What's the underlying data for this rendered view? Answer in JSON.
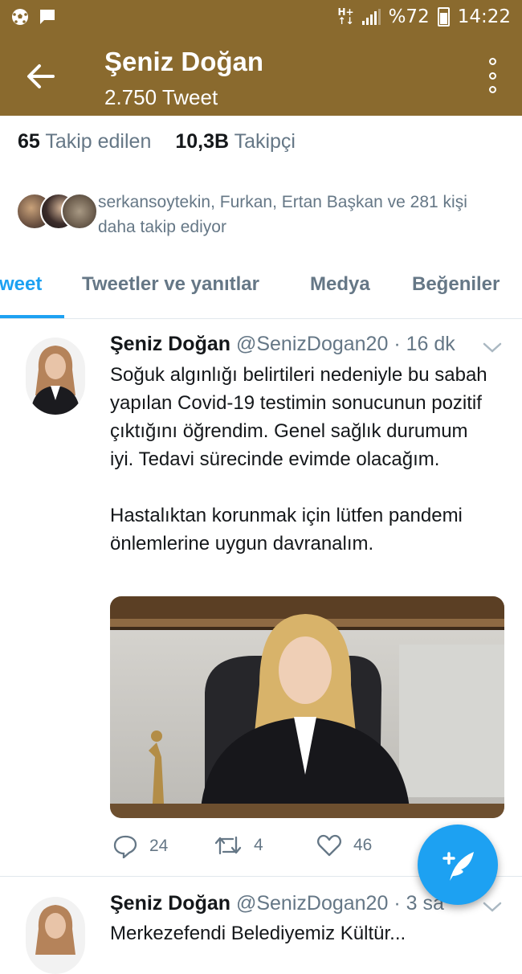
{
  "status_bar": {
    "net_top": "H+",
    "net_bottom": "↑↓",
    "battery_text": "%72",
    "time": "14:22",
    "icons": [
      "soccer-ball-icon",
      "message-icon",
      "signal-icon",
      "battery-icon"
    ]
  },
  "header": {
    "name": "Şeniz Doğan",
    "tweet_count": "2.750 Tweet",
    "back_icon": "arrow-left-icon",
    "more_icon": "more-vertical-icon"
  },
  "profile_stats": {
    "following_count": "65",
    "following_label": "Takip edilen",
    "followers_count": "10,3B",
    "followers_label": "Takipçi"
  },
  "followed_by": "serkansoytekin, Furkan, Ertan Başkan ve 281 kişi daha takip ediyor",
  "tabs": [
    {
      "label": "Tweetler",
      "visible_text": "weet",
      "active": true
    },
    {
      "label": "Tweetler ve yanıtlar",
      "active": false
    },
    {
      "label": "Medya",
      "active": false
    },
    {
      "label": "Beğeniler",
      "active": false
    }
  ],
  "tweets": [
    {
      "name": "Şeniz Doğan",
      "handle": "@SenizDogan20",
      "time": "· 16 dk",
      "paragraphs": [
        "Soğuk algınlığı belirtileri nedeniyle bu sabah yapılan Covid-19 testimin sonucunun pozitif çıktığını öğrendim. Genel sağlık durumum iyi. Tedavi sürecinde evimde olacağım.",
        "Hastalıktan korunmak için lütfen pandemi önlemlerine uygun davranalım."
      ],
      "replies": "24",
      "retweets": "4",
      "likes": "46"
    },
    {
      "name": "Şeniz Doğan",
      "handle": "@SenizDogan20",
      "time": "· 3 sa",
      "text_preview": "Merkezefendi Belediyemiz Kültür..."
    }
  ],
  "fab": {
    "icon": "compose-tweet-icon"
  },
  "colors": {
    "header_bg": "#8a6a2e",
    "accent": "#1da1f2",
    "secondary_text": "#657786"
  }
}
